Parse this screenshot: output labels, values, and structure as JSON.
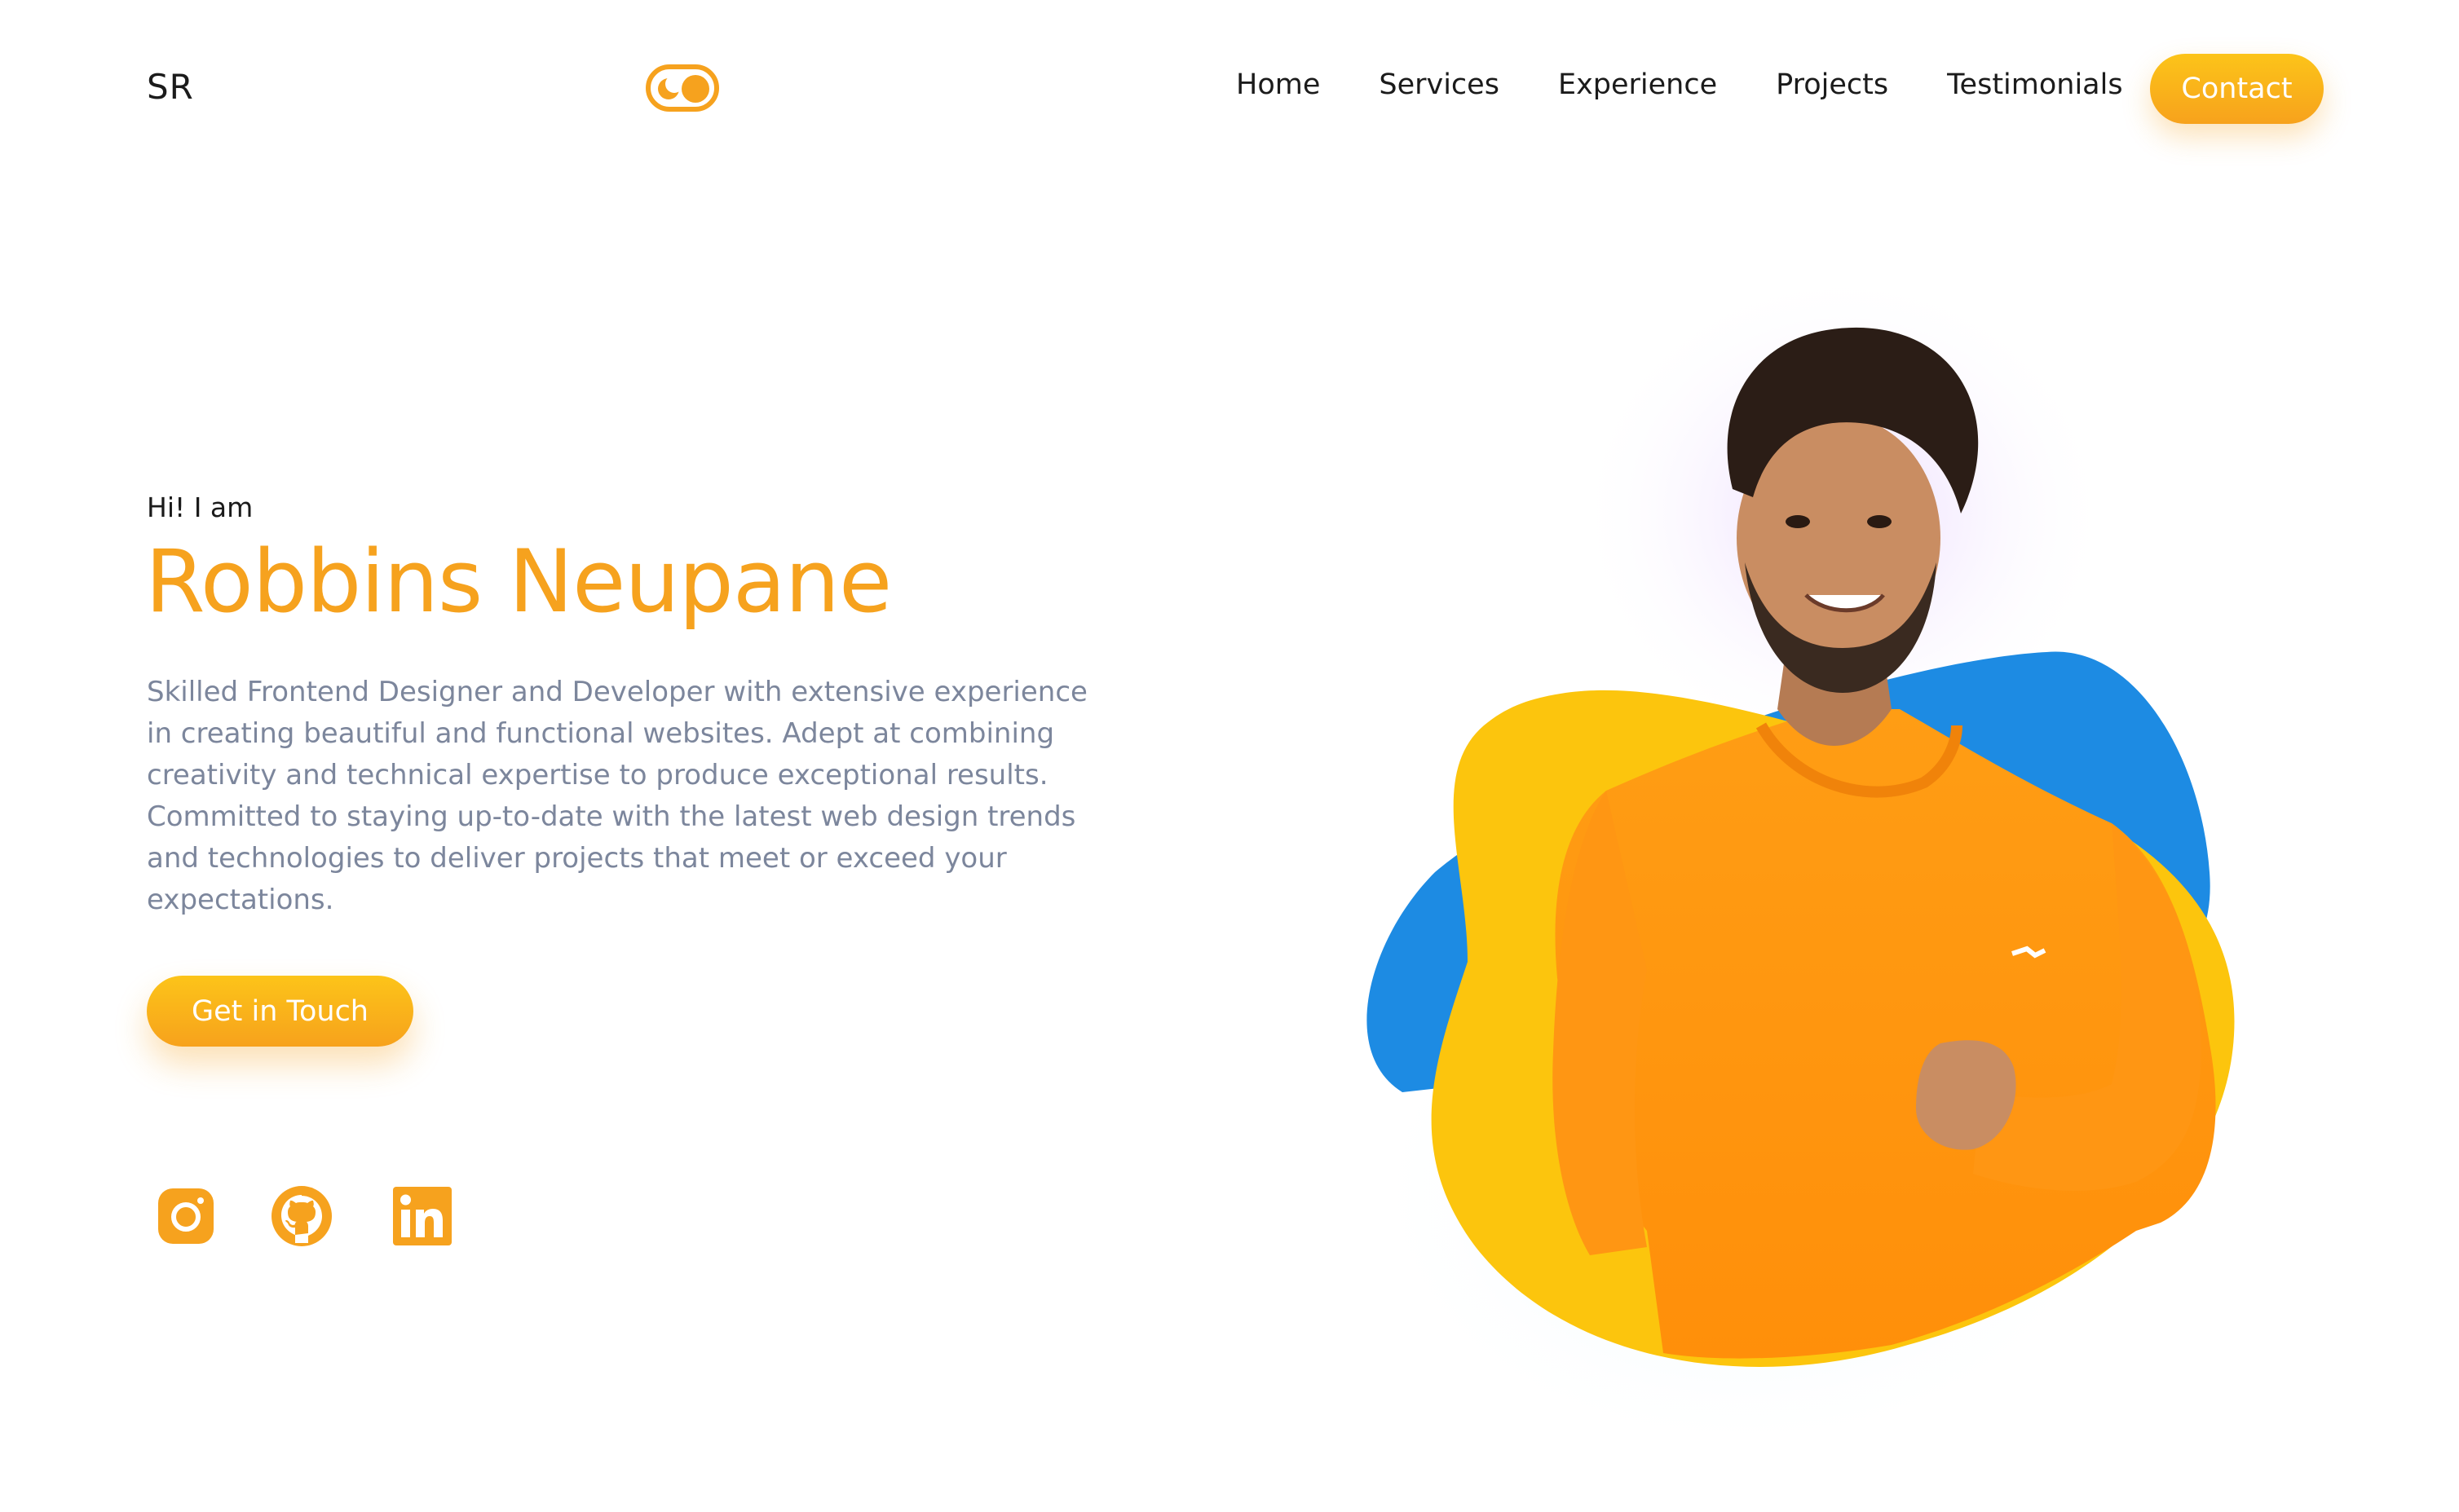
{
  "header": {
    "logo": "SR",
    "toggle_icon": "theme-toggle-icon",
    "nav": [
      {
        "label": "Home"
      },
      {
        "label": "Services"
      },
      {
        "label": "Experience"
      },
      {
        "label": "Projects"
      },
      {
        "label": "Testimonials"
      }
    ],
    "contact_label": "Contact"
  },
  "hero": {
    "greeting": "Hi! I am",
    "name": "Robbins Neupane",
    "bio": "Skilled Frontend Designer and Developer with extensive experience in creating beautiful and functional websites. Adept at combining creativity and technical expertise to produce exceptional results. Committed to staying up-to-date with the latest web design trends and technologies to deliver projects that meet or exceed your expectations.",
    "cta_label": "Get in Touch"
  },
  "socials": [
    {
      "icon": "instagram-icon"
    },
    {
      "icon": "github-icon"
    },
    {
      "icon": "linkedin-icon"
    }
  ],
  "colors": {
    "accent": "#f6a21e",
    "accent_light": "#fcc419",
    "text_dark": "#1b1b1b",
    "text_muted": "#7c869c",
    "blob_yellow": "#fcc50d",
    "blob_blue": "#1d8be3",
    "shirt_orange": "#ff9a12"
  }
}
